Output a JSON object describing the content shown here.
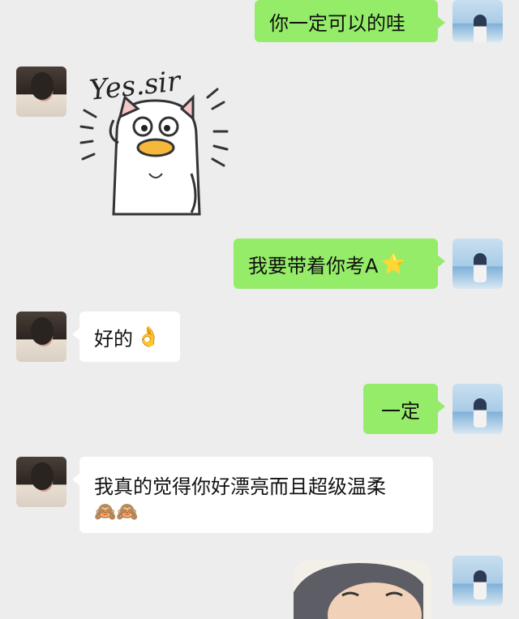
{
  "messages": [
    {
      "from": "me",
      "text": "你一定可以的哇"
    },
    {
      "from": "them",
      "type": "sticker",
      "text": "Yes.sir"
    },
    {
      "from": "me",
      "text": "我要带着你考A",
      "emoji": "⭐"
    },
    {
      "from": "them",
      "text": "好的",
      "emoji": "👌"
    },
    {
      "from": "me",
      "text": "一定"
    },
    {
      "from": "them",
      "text": "我真的觉得你好漂亮而且超级温柔",
      "emoji": "🙈🙈"
    },
    {
      "from": "me",
      "type": "photo"
    }
  ],
  "colors": {
    "me_bubble": "#95ec69",
    "them_bubble": "#ffffff",
    "background": "#ededed"
  },
  "icons": {
    "avatar_them": "avatar-girl",
    "avatar_me": "avatar-blue-sky"
  }
}
